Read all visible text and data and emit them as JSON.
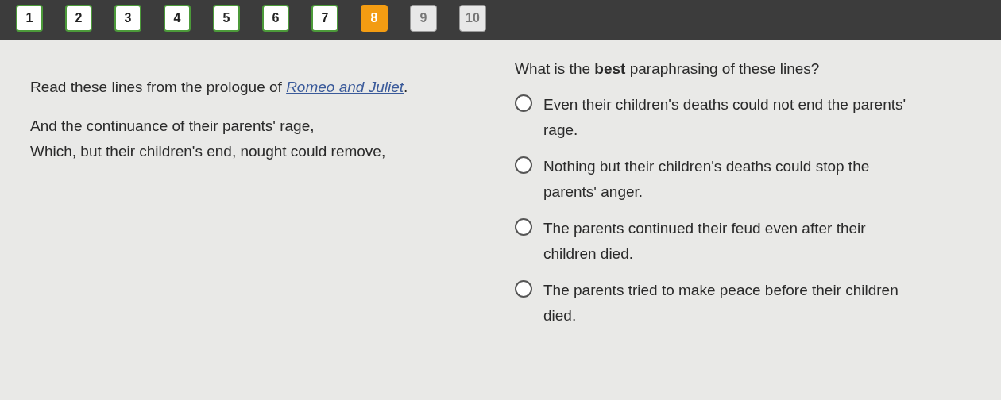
{
  "question_nav": [
    {
      "label": "1",
      "answered": true,
      "selected": false
    },
    {
      "label": "2",
      "answered": true,
      "selected": false
    },
    {
      "label": "3",
      "answered": true,
      "selected": false
    },
    {
      "label": "4",
      "answered": true,
      "selected": false
    },
    {
      "label": "5",
      "answered": true,
      "selected": false
    },
    {
      "label": "6",
      "answered": true,
      "selected": false
    },
    {
      "label": "7",
      "answered": true,
      "selected": false
    },
    {
      "label": "8",
      "answered": false,
      "selected": true
    },
    {
      "label": "9",
      "answered": false,
      "selected": false
    },
    {
      "label": "10",
      "answered": false,
      "selected": false
    }
  ],
  "passage": {
    "intro": "Read these lines from the prologue of",
    "title_link": "Romeo and Juliet",
    "intro_end": ".",
    "lines": [
      "And the continuance of their parents' rage,",
      "Which, but their children's end, nought could remove,"
    ]
  },
  "question": {
    "prompt": "What is the **best** paraphrasing of these lines?",
    "options": [
      {
        "text": "Even their children's deaths could not end the parents' rage.",
        "selected": false
      },
      {
        "text": "Nothing but their children's deaths could stop the parents' anger.",
        "selected": false
      },
      {
        "text": "The parents continued their feud even after their children died.",
        "selected": false
      },
      {
        "text": "The parents tried to make peace before their children died.",
        "selected": false
      }
    ]
  }
}
